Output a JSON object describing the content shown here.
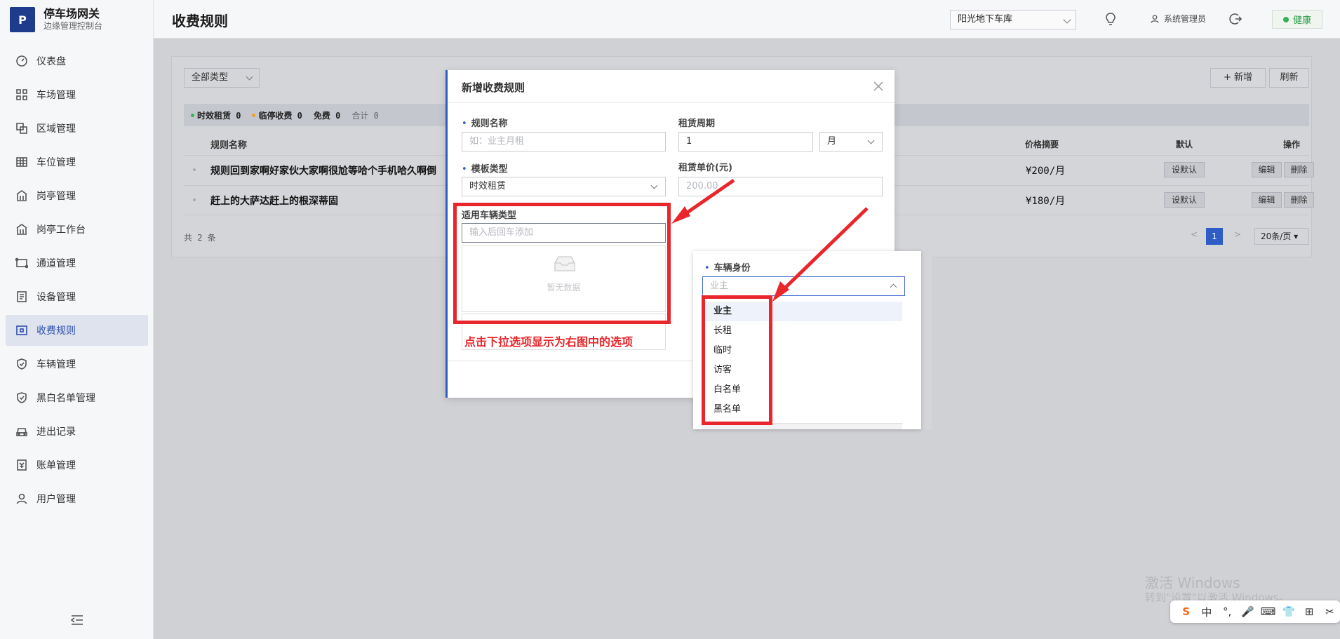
{
  "app": {
    "logo_letter": "P",
    "title": "停车场网关",
    "subtitle": "边缘管理控制台"
  },
  "sidebar": {
    "items": [
      {
        "label": "仪表盘",
        "icon": "dashboard-icon"
      },
      {
        "label": "车场管理",
        "icon": "grid-icon"
      },
      {
        "label": "区域管理",
        "icon": "area-icon"
      },
      {
        "label": "车位管理",
        "icon": "table-icon"
      },
      {
        "label": "岗亭管理",
        "icon": "booth-icon"
      },
      {
        "label": "岗亭工作台",
        "icon": "booth-icon"
      },
      {
        "label": "通道管理",
        "icon": "channel-icon"
      },
      {
        "label": "设备管理",
        "icon": "device-icon"
      },
      {
        "label": "收费规则",
        "icon": "wallet-icon",
        "active": true
      },
      {
        "label": "车辆管理",
        "icon": "shield-icon"
      },
      {
        "label": "黑白名单管理",
        "icon": "shield-icon"
      },
      {
        "label": "进出记录",
        "icon": "car-icon"
      },
      {
        "label": "账单管理",
        "icon": "bill-icon"
      },
      {
        "label": "用户管理",
        "icon": "user-icon"
      }
    ]
  },
  "header": {
    "page_title": "收费规则",
    "lot_select": "阳光地下车库",
    "user": "系统管理员",
    "health": "健康"
  },
  "toolbar": {
    "type_filter": "全部类型",
    "add_label": "+ 新增",
    "refresh_label": "刷新"
  },
  "stats": {
    "timed": "时效租赁 0",
    "temp": "临停收费 0",
    "free": "免费 0",
    "total": "合计 0"
  },
  "table": {
    "columns": {
      "name": "规则名称",
      "price": "价格摘要",
      "default": "默认",
      "actions": "操作"
    },
    "rows": [
      {
        "name": "规则回到家啊好家伙大家啊很尬等哈个手机哈久啊倒",
        "price": "¥200/月",
        "set_default": "设默认",
        "edit": "编辑",
        "delete": "删除"
      },
      {
        "name": "赶上的大萨达赶上的根深蒂固",
        "price": "¥180/月",
        "set_default": "设默认",
        "edit": "编辑",
        "delete": "删除"
      }
    ],
    "footer_count": "共 2 条",
    "page": "1",
    "page_size": "20条/页"
  },
  "modal": {
    "title": "新增收费规则",
    "rule_name_label": "规则名称",
    "rule_name_placeholder": "如：业主月租",
    "period_label": "租赁周期",
    "period_value": "1",
    "period_unit": "月",
    "template_label": "模板类型",
    "template_value": "时效租赁",
    "unit_price_label": "租赁单价(元)",
    "unit_price_placeholder": "200.00",
    "vehicle_type_label": "适用车辆类型",
    "vehicle_type_placeholder": "输入后回车添加",
    "empty_text": "暂无数据"
  },
  "dropdown": {
    "label": "车辆身份",
    "placeholder": "业主",
    "options": [
      "业主",
      "长租",
      "临时",
      "访客",
      "白名单",
      "黑名单"
    ],
    "selected": "业主"
  },
  "annotation": {
    "note": "点击下拉选项显示为右图中的选项",
    "color": "#e8262b"
  },
  "watermark": {
    "line1": "激活 Windows",
    "line2": "转到\"设置\"以激活 Windows。"
  },
  "ime": {
    "items": [
      "S",
      "中",
      "°,",
      "🎤",
      "⌨",
      "👕",
      "⊞",
      "✂"
    ]
  },
  "colors": {
    "accent": "#2f5dc6",
    "health_green": "#2fb559",
    "stat_green": "#2fb559",
    "stat_orange": "#f0a020"
  }
}
